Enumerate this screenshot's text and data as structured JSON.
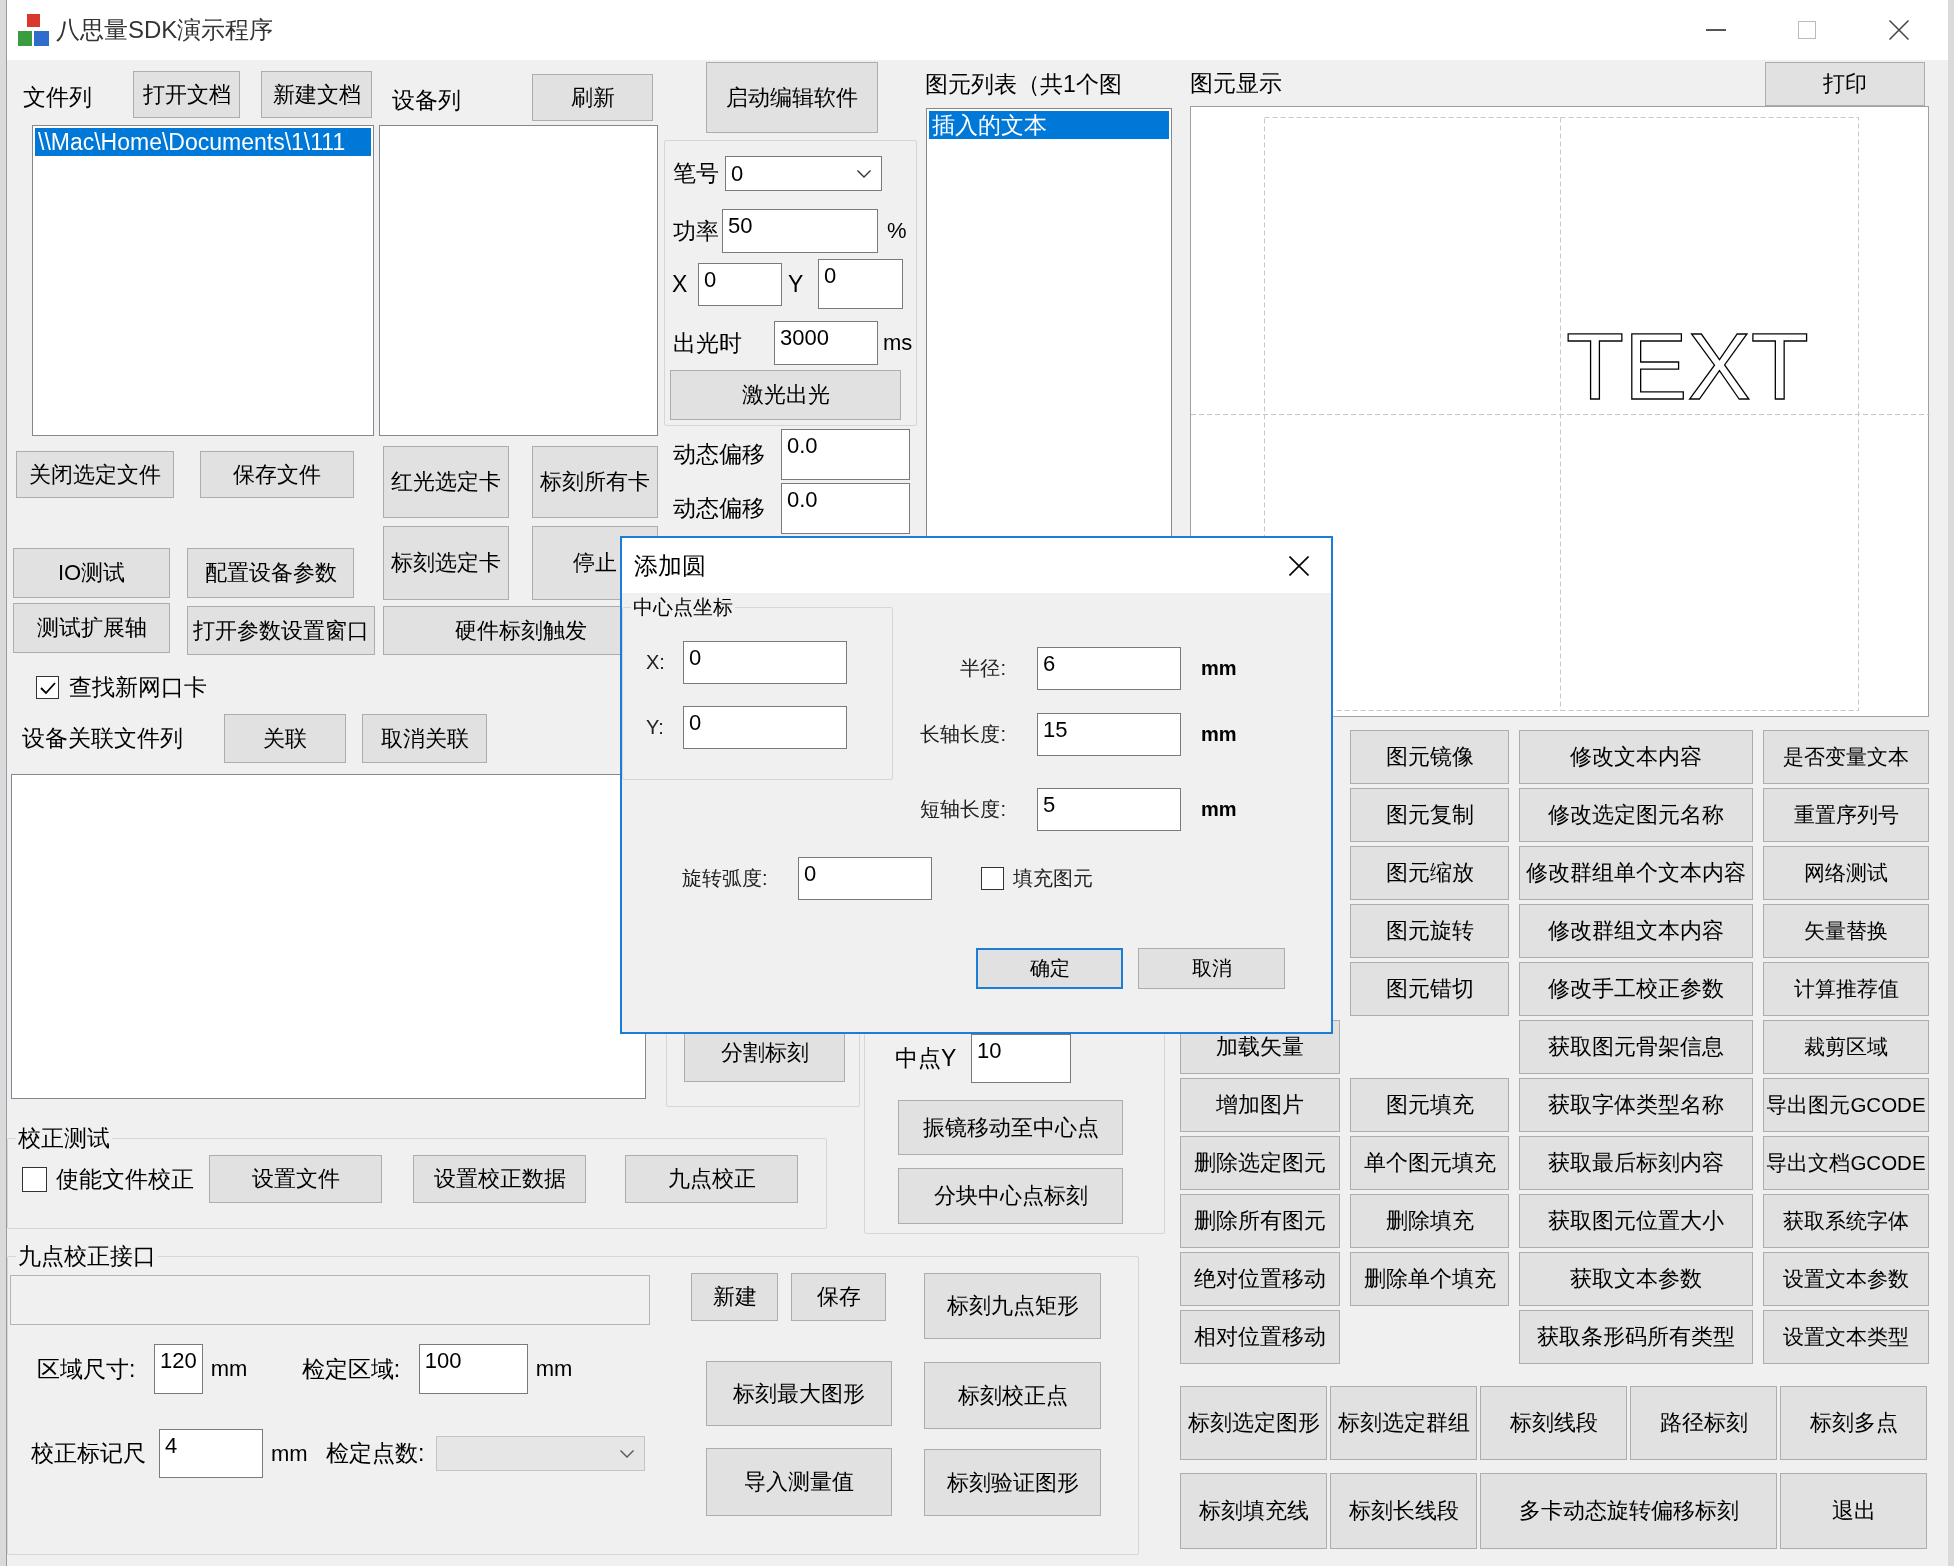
{
  "window": {
    "title": "八思量SDK演示程序"
  },
  "file_panel": {
    "label": "文件列",
    "buttons": [
      "打开文档",
      "新建文档"
    ],
    "files": [
      {
        "text": "\\\\Mac\\Home\\Documents\\1\\111",
        "selected": true
      }
    ]
  },
  "device_panel": {
    "label": "设备列",
    "refresh_button": "刷新"
  },
  "launch_button": "启动编辑软件",
  "laser_group": {
    "pen": {
      "label": "笔号",
      "value": "0"
    },
    "power": {
      "label": "功率",
      "value": "50",
      "unit": "%"
    },
    "x": {
      "label": "X",
      "value": "0"
    },
    "y": {
      "label": "Y",
      "value": "0"
    },
    "duration": {
      "label": "出光时",
      "value": "3000",
      "unit": "ms"
    },
    "button": "激光出光"
  },
  "dynamic_offsets": [
    {
      "label": "动态偏移",
      "value": "0.0"
    },
    {
      "label": "动态偏移",
      "value": "0.0"
    }
  ],
  "file_buttons": [
    [
      "关闭选定文件",
      "保存文件"
    ],
    [
      "IO测试",
      "配置设备参数"
    ],
    [
      "测试扩展轴",
      "打开参数设置窗口"
    ]
  ],
  "card_buttons": [
    [
      "红光选定卡",
      "标刻所有卡"
    ],
    [
      "标刻选定卡",
      "停止"
    ],
    [
      "硬件标刻触发"
    ]
  ],
  "find_nic": {
    "label": "查找新网口卡",
    "checked": true
  },
  "association": {
    "label": "设备关联文件列",
    "buttons": [
      "关联",
      "取消关联"
    ]
  },
  "element_list": {
    "label": "图元列表（共1个图",
    "items": [
      {
        "text": "插入的文本",
        "selected": true
      }
    ]
  },
  "display": {
    "label": "图元显示",
    "print_button": "打印",
    "canvas_text": "TEXT"
  },
  "split_button": "分割标刻",
  "center_group": {
    "label": "中点Y",
    "value": "10",
    "buttons": [
      "振镜移动至中心点",
      "分块中心点标刻"
    ]
  },
  "calibration_test": {
    "title": "校正测试",
    "checkbox": {
      "label": "使能文件校正",
      "checked": false
    },
    "buttons": [
      "设置文件",
      "设置校正数据",
      "九点校正"
    ]
  },
  "nine_point": {
    "title": "九点校正接口",
    "path_field": {
      "disabled": true
    },
    "file_buttons": [
      "新建",
      "保存"
    ],
    "size_fields": [
      {
        "label": "区域尺寸:",
        "value": "120",
        "unit": "mm"
      },
      {
        "label": "检定区域:",
        "value": "100",
        "unit": "mm"
      }
    ],
    "marker_field": {
      "label": "校正标记尺",
      "value": "4",
      "unit": "mm"
    },
    "point_count": {
      "label": "检定点数:",
      "disabled": true
    },
    "middle_buttons": [
      "标刻最大图形",
      "导入测量值"
    ],
    "right_buttons": [
      "标刻九点矩形",
      "标刻校正点",
      "标刻验证图形"
    ]
  },
  "tools": {
    "vector_buttons": [
      "加载矢量",
      "增加图片",
      "删除选定图元",
      "删除所有图元",
      "绝对位置移动",
      "相对位置移动"
    ],
    "transform_buttons": [
      "图元镜像",
      "图元复制",
      "图元缩放",
      "图元旋转",
      "图元错切"
    ],
    "fill_buttons": [
      "图元填充",
      "单个图元填充",
      "删除填充",
      "删除单个填充"
    ],
    "text_buttons": [
      "修改文本内容",
      "修改选定图元名称",
      "修改群组单个文本内容",
      "修改群组文本内容",
      "修改手工校正参数",
      "获取图元骨架信息",
      "获取字体类型名称",
      "获取最后标刻内容",
      "获取图元位置大小",
      "获取文本参数",
      "获取条形码所有类型"
    ],
    "misc_buttons": [
      "是否变量文本",
      "重置序列号",
      "网络测试",
      "矢量替换",
      "计算推荐值",
      "裁剪区域",
      "导出图元GCODE",
      "导出文档GCODE",
      "获取系统字体",
      "设置文本参数",
      "设置文本类型"
    ]
  },
  "mark_buttons": [
    [
      {
        "label": "标刻选定图形",
        "kind": "single"
      },
      {
        "label": "标刻选定群组",
        "kind": "single"
      },
      {
        "label": "标刻线段",
        "kind": "single"
      },
      {
        "label": "路径标刻",
        "kind": "single"
      },
      {
        "label": "标刻多点",
        "kind": "single"
      }
    ],
    [
      {
        "label": "标刻填充线",
        "kind": "single"
      },
      {
        "label": "标刻长线段",
        "kind": "single"
      },
      {
        "label": "多卡动态旋转偏移标刻",
        "kind": "double"
      },
      {
        "label": "退出",
        "kind": "single"
      }
    ]
  ],
  "dialog": {
    "title": "添加圆",
    "center_group": {
      "title": "中心点坐标",
      "fields": [
        {
          "label": "X:",
          "value": "0"
        },
        {
          "label": "Y:",
          "value": "0"
        }
      ]
    },
    "size_fields": [
      {
        "label": "半径:",
        "value": "6",
        "unit": "mm"
      },
      {
        "label": "长轴长度:",
        "value": "15",
        "unit": "mm"
      },
      {
        "label": "短轴长度:",
        "value": "5",
        "unit": "mm"
      }
    ],
    "rotation": {
      "label": "旋转弧度:",
      "value": "0"
    },
    "fill": {
      "label": "填充图元",
      "checked": false
    },
    "buttons": [
      {
        "label": "确定",
        "focused": true
      },
      {
        "label": "取消",
        "focused": false
      }
    ]
  }
}
